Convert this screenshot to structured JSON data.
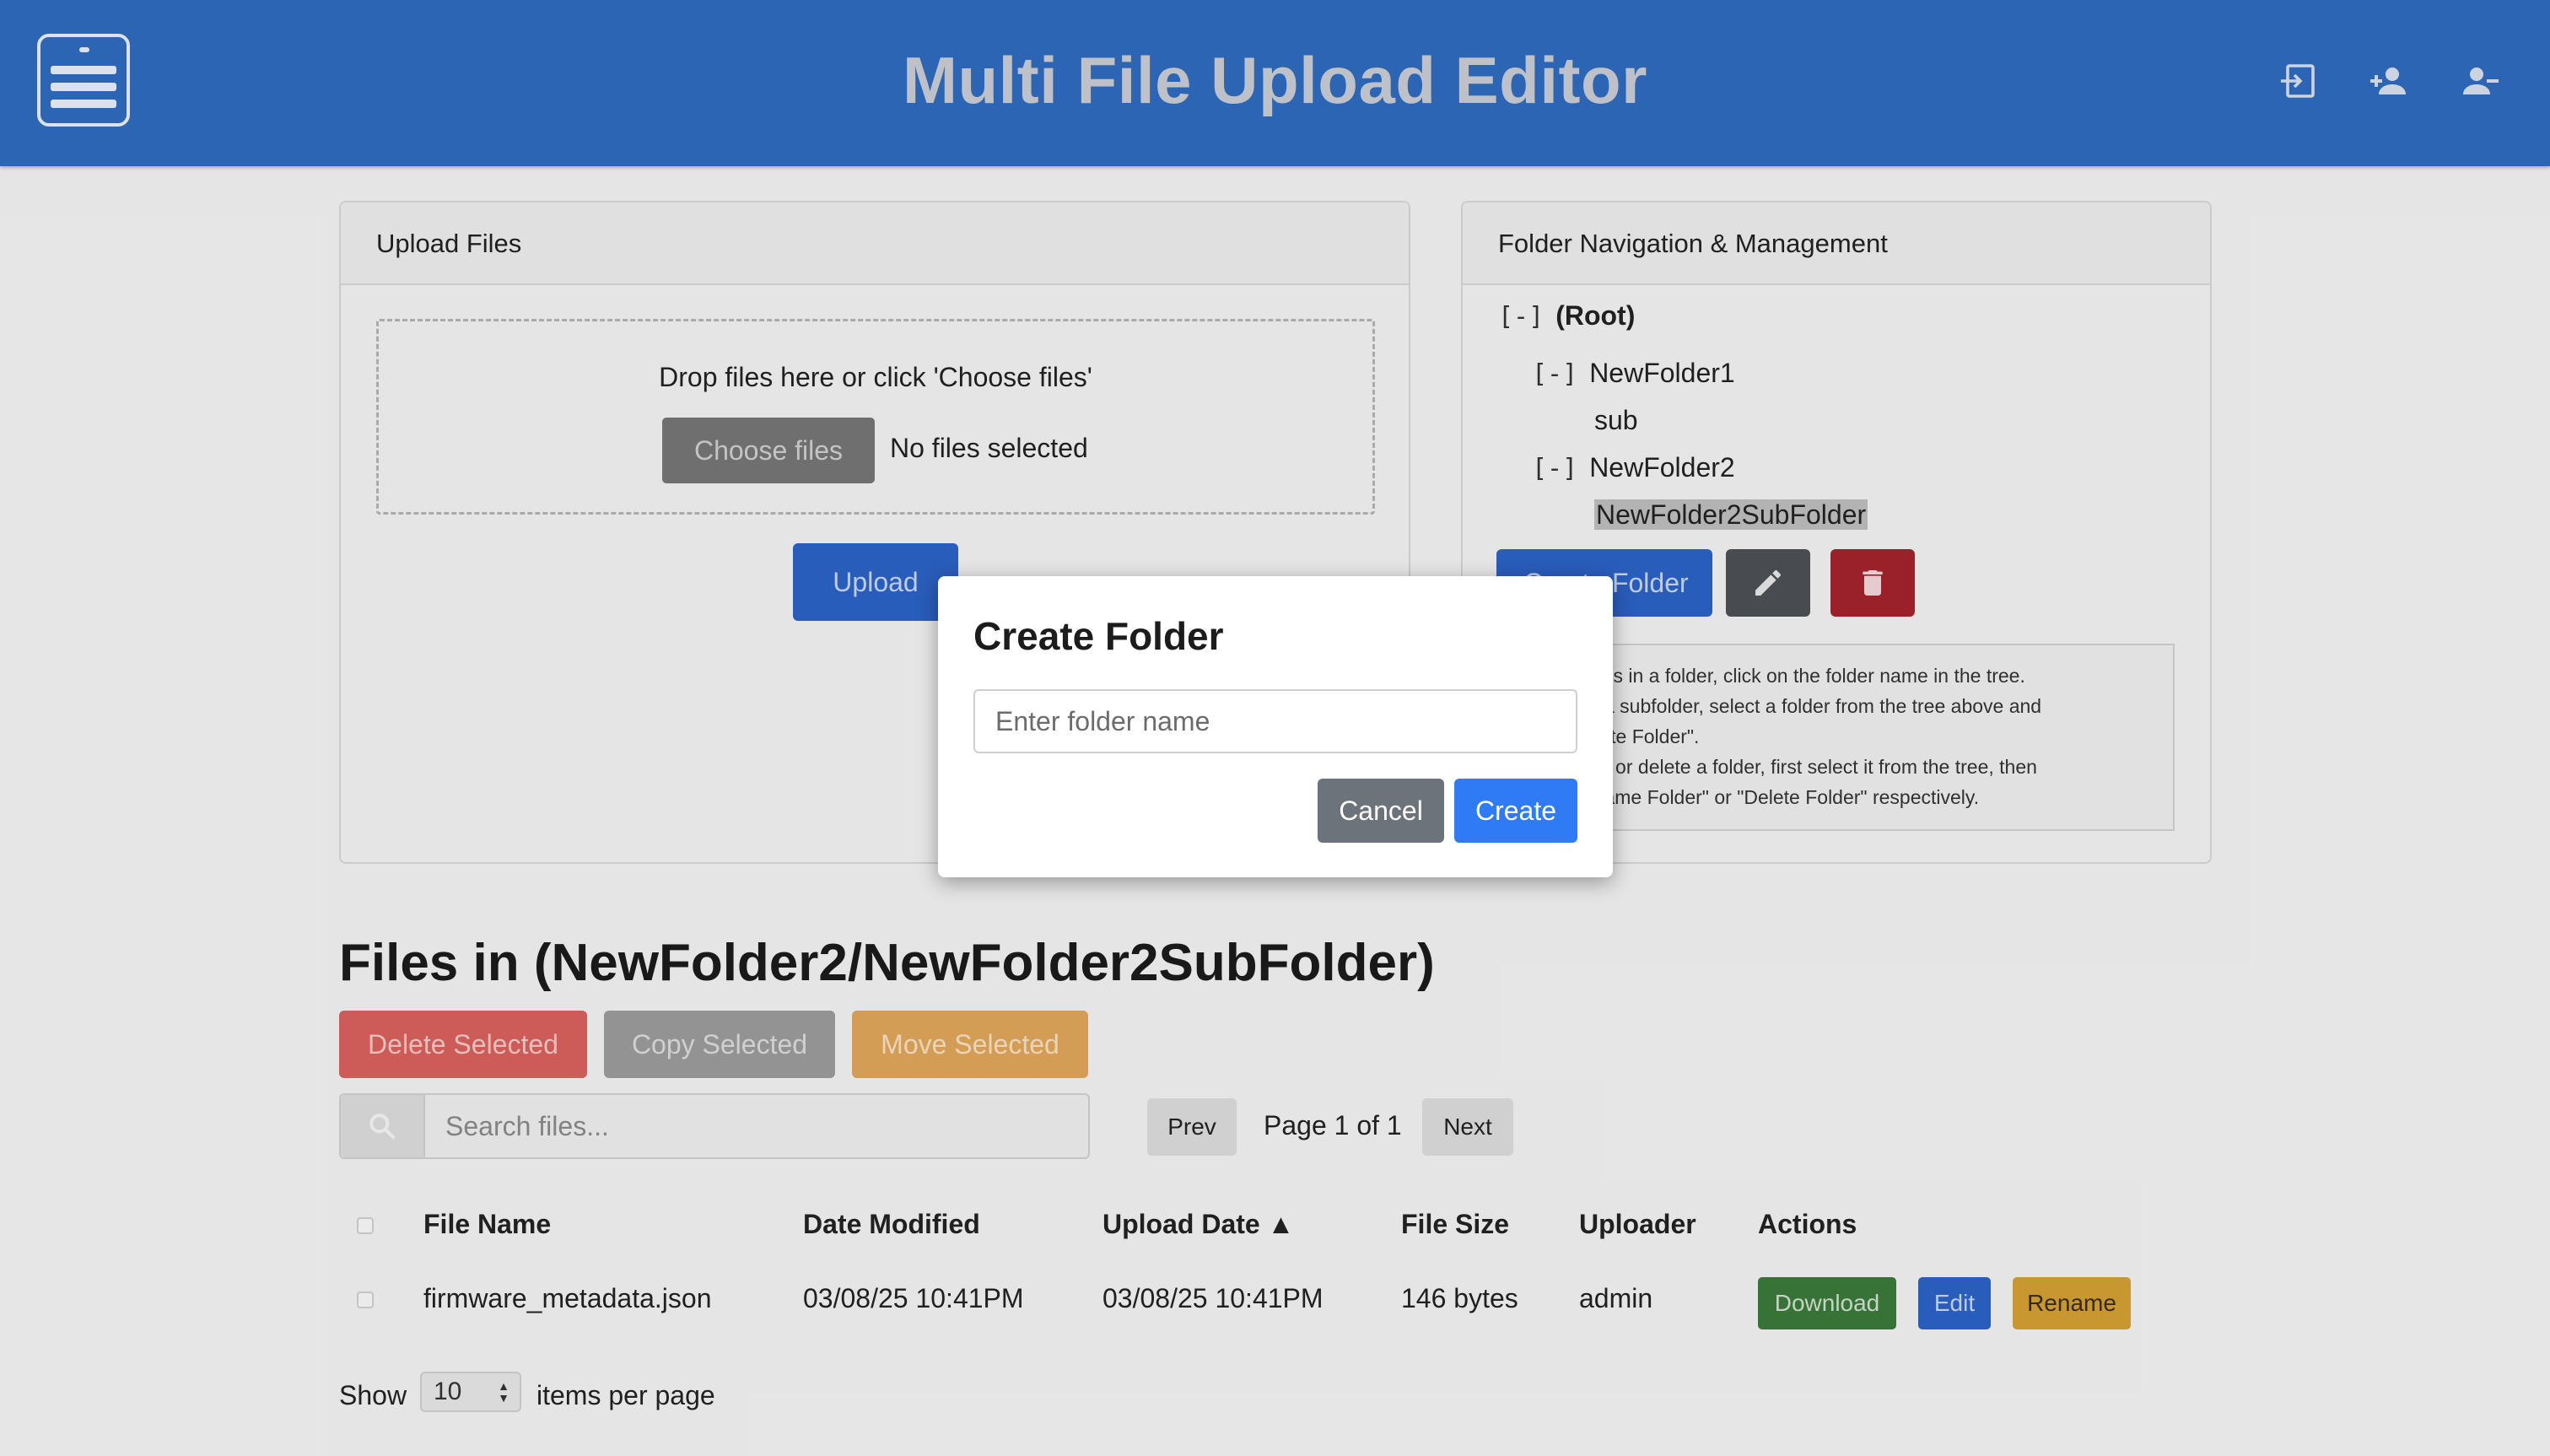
{
  "header": {
    "title": "Multi File Upload Editor",
    "icons": [
      "menu-icon",
      "login-icon",
      "add-user-icon",
      "remove-user-icon"
    ]
  },
  "upload": {
    "title": "Upload Files",
    "drop_text": "Drop files here or click 'Choose files'",
    "choose_label": "Choose files",
    "no_files": "No files selected",
    "upload_label": "Upload"
  },
  "folders": {
    "title": "Folder Navigation & Management",
    "toggle": "[-]",
    "root": "(Root)",
    "items": [
      {
        "label": "NewFolder1"
      },
      {
        "label": "sub"
      },
      {
        "label": "NewFolder2"
      },
      {
        "label": "NewFolder2SubFolder"
      }
    ],
    "create_label": "Create Folder",
    "help": [
      "To view files in a folder, click on the folder name in the tree.",
      "To create a subfolder, select a folder from the tree above and",
      "click \"Create Folder\".",
      "To rename or delete a folder, first select it from the tree, then",
      "click \"Rename Folder\" or \"Delete Folder\" respectively."
    ]
  },
  "files": {
    "title": "Files in (NewFolder2/NewFolder2SubFolder)",
    "delete_selected": "Delete Selected",
    "copy_selected": "Copy Selected",
    "move_selected": "Move Selected",
    "search_placeholder": "Search files...",
    "prev_label": "Prev",
    "page_info": "Page 1 of 1",
    "next_label": "Next",
    "columns": [
      "File Name",
      "Date Modified",
      "Upload Date ▲",
      "File Size",
      "Uploader",
      "Actions"
    ],
    "rows": [
      {
        "name": "firmware_metadata.json",
        "modified": "03/08/25 10:41PM",
        "uploaded": "03/08/25 10:41PM",
        "size": "146 bytes",
        "uploader": "admin",
        "download_label": "Download",
        "edit_label": "Edit",
        "rename_label": "Rename"
      }
    ],
    "show_label": "Show",
    "per_page": "10",
    "per_page_label": "items per page"
  },
  "modal": {
    "title": "Create Folder",
    "placeholder": "Enter folder name",
    "cancel_label": "Cancel",
    "create_label": "Create"
  },
  "colors": {
    "header": "#2f6bbd",
    "primary": "#2c62c6",
    "danger": "#a3222c",
    "warning": "#d3a032",
    "success": "#3a7a3a",
    "modal_create": "#2f7bf5"
  }
}
